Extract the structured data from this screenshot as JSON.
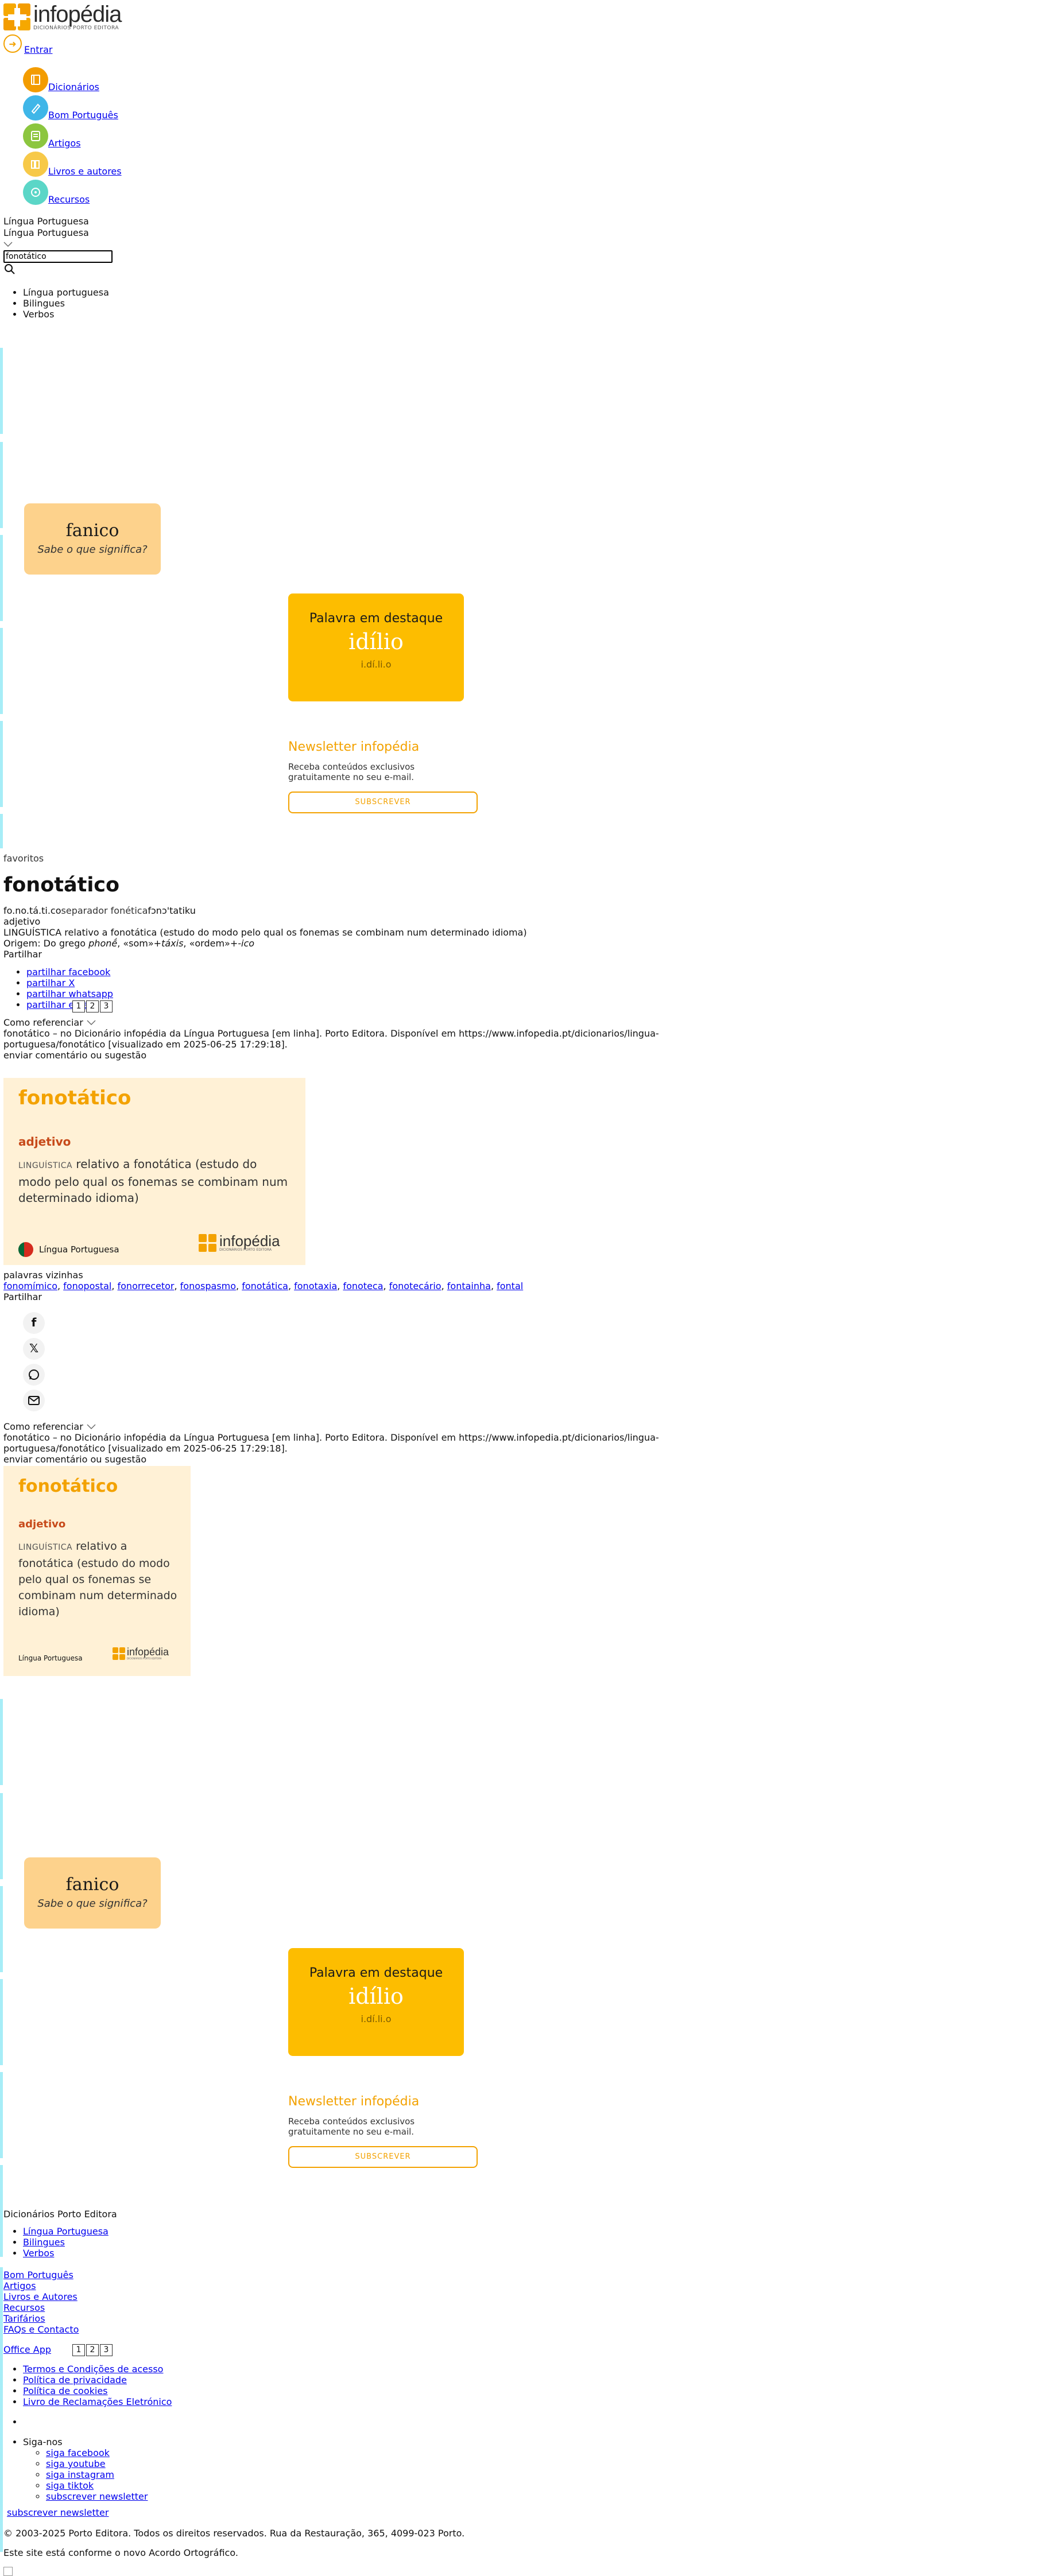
{
  "header": {
    "logo_name": "infopédia",
    "logo_sub": "DICIONÁRIOS PORTO EDITORA",
    "login_label": "Entrar"
  },
  "nav": [
    {
      "label": "Dicionários",
      "icon": "book-icon",
      "color": "#f39c00"
    },
    {
      "label": "Bom Português",
      "icon": "pen-icon",
      "color": "#3fb6e8"
    },
    {
      "label": "Artigos",
      "icon": "article-icon",
      "color": "#8cc63f"
    },
    {
      "label": "Livros e autores",
      "icon": "books-icon",
      "color": "#f7c948"
    },
    {
      "label": "Recursos",
      "icon": "resources-icon",
      "color": "#5bd6c7"
    }
  ],
  "search": {
    "dictionary_label": "Língua Portuguesa",
    "dictionary_selected": "Língua Portuguesa",
    "query": "fonotático",
    "options": [
      "Língua portuguesa",
      "Bilingues",
      "Verbos"
    ]
  },
  "promo": {
    "fanico_word": "fanico",
    "fanico_question": "Sabe o que significa?",
    "highlight_title": "Palavra em destaque",
    "highlight_word": "idílio",
    "highlight_syllables": "i.dí.li.o",
    "newsletter_title": "Newsletter infopédia",
    "newsletter_desc_1": "Receba conteúdos exclusivos",
    "newsletter_desc_2": "gratuitamente no seu e-mail.",
    "newsletter_button": "SUBSCREVER"
  },
  "entry": {
    "favorites_alt": "favoritos",
    "headword": "fonotático",
    "syllables": "fo.no.tá.ti.co",
    "separator_alt": "separador fonética",
    "phonetic": "fɔnɔ'tatiku",
    "category": "adjetivo",
    "domain": "LINGUÍSTICA",
    "definition": "relativo a fonotática (estudo do modo pelo qual os fonemas se combinam num determinado idioma)",
    "origin_prefix": "Origem: Do grego ",
    "origin_1": "phonḗ",
    "origin_2": ", «som»+",
    "origin_3": "táxis",
    "origin_4": ", «ordem»+",
    "origin_5": "-ico",
    "share_label": "Partilhar",
    "share_links": [
      "partilhar facebook",
      "partilhar X",
      "partilhar whatsapp",
      "partilhar email"
    ],
    "pager": [
      "1",
      "2",
      "3"
    ],
    "cite_label": "Como referenciar",
    "cite_line1": "fonotático – no Dicionário infopédia da Língua Portuguesa [em linha]. Porto Editora. Disponível em https://www.infopedia.pt/dicionarios/lingua-",
    "cite_line2": "portuguesa/fonotático [visualizado em 2025-06-25 17:29:18].",
    "feedback": "enviar comentário ou sugestão",
    "card_lang": "Língua Portuguesa",
    "neighbors_label": "palavras vizinhas",
    "neighbors": [
      "fonomímico",
      "fonopostal",
      "fonorrecetor",
      "fonospasmo",
      "fonotática",
      "fonotaxia",
      "fonoteca",
      "fonotecário",
      "fontainha",
      "fontal"
    ],
    "share_label_2": "Partilhar",
    "social_icons": [
      "facebook-icon",
      "x-icon",
      "whatsapp-icon",
      "email-icon"
    ]
  },
  "footer": {
    "section_title": "Dicionários Porto Editora",
    "dict_links": [
      "Língua Portuguesa",
      "Bilingues",
      "Verbos"
    ],
    "other_links": [
      "Bom Português",
      "Artigos",
      "Livros e Autores",
      "Recursos",
      "Tarifários",
      "FAQs e Contacto"
    ],
    "office_app": "Office App",
    "legal_links": [
      "Termos e Condições de acesso",
      "Política de privacidade",
      "Política de cookies",
      "Livro de Reclamações Eletrónico"
    ],
    "follow_label": "Siga-nos",
    "follow_links": [
      "siga facebook",
      "siga youtube",
      "siga instagram",
      "siga tiktok"
    ],
    "subscribe_link": "subscrever newsletter",
    "subscribe_link_2": "subscrever newsletter",
    "copyright": "© 2003-2025 Porto Editora. Todos os direitos reservados. Rua da Restauração, 365, 4099-023 Porto.",
    "ao_note": "Este site está conforme o novo Acordo Ortográfico."
  },
  "colors": {
    "brand_orange": "#f3a200",
    "stripe_cyan": "#a7edf7",
    "fanico_bg": "#fdd28c",
    "highlight_bg": "#fdbd00",
    "card_bg": "#fff1d6",
    "category_red": "#c74a1a"
  }
}
